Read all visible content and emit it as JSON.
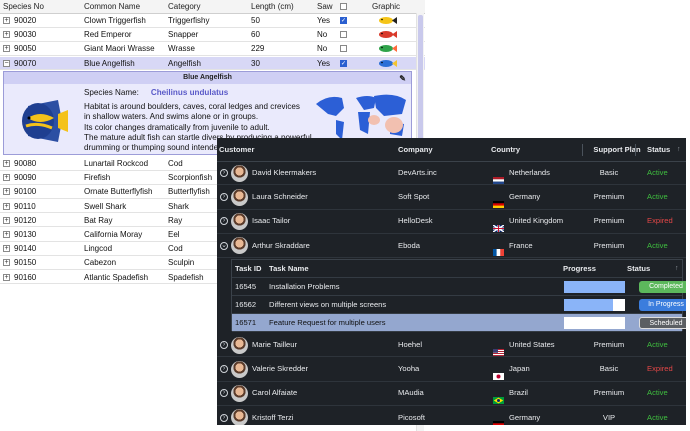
{
  "grid1": {
    "headers": [
      "Species No",
      "Common Name",
      "Category",
      "Length (cm)",
      "Saw",
      "Graphic"
    ],
    "rows_top": [
      {
        "no": "90020",
        "name": "Clown Triggerfish",
        "cat": "Triggerfishy",
        "len": "50",
        "saw": "Yes",
        "checked": true
      },
      {
        "no": "90030",
        "name": "Red Emperor",
        "cat": "Snapper",
        "len": "60",
        "saw": "No",
        "checked": false
      },
      {
        "no": "90050",
        "name": "Giant Maori Wrasse",
        "cat": "Wrasse",
        "len": "229",
        "saw": "No",
        "checked": false
      },
      {
        "no": "90070",
        "name": "Blue Angelfish",
        "cat": "Angelfish",
        "len": "30",
        "saw": "Yes",
        "checked": true
      }
    ],
    "detail": {
      "title": "Blue Angelfish",
      "species_label": "Species Name:",
      "species": "Cheilinus undulatus",
      "lines": [
        "Habitat is around boulders, caves, coral ledges and crevices",
        "in shallow waters. And swims alone or in groups.",
        "Its color changes dramatically from juvenile to adult.",
        "The mature adult fish can startle divers by producing a powerful",
        "drumming or thumping sound intended"
      ]
    },
    "rows_bottom": [
      {
        "no": "90080",
        "name": "Lunartail Rockcod",
        "cat": "Cod"
      },
      {
        "no": "90090",
        "name": "Firefish",
        "cat": "Scorpionfish"
      },
      {
        "no": "90100",
        "name": "Ornate Butterflyfish",
        "cat": "Butterflyfish"
      },
      {
        "no": "90110",
        "name": "Swell Shark",
        "cat": "Shark"
      },
      {
        "no": "90120",
        "name": "Bat Ray",
        "cat": "Ray"
      },
      {
        "no": "90130",
        "name": "California Moray",
        "cat": "Eel"
      },
      {
        "no": "90140",
        "name": "Lingcod",
        "cat": "Cod"
      },
      {
        "no": "90150",
        "name": "Cabezon",
        "cat": "Sculpin"
      },
      {
        "no": "90160",
        "name": "Atlantic Spadefish",
        "cat": "Spadefish"
      }
    ]
  },
  "grid2": {
    "headers": [
      "Customer",
      "Company",
      "Country",
      "Support Plan",
      "Status"
    ],
    "rows_top": [
      {
        "name": "David Kleermakers",
        "company": "DevArts.inc",
        "country": "Netherlands",
        "flag": "nl",
        "plan": "Basic",
        "status": "Active"
      },
      {
        "name": "Laura Schneider",
        "company": "Soft Spot",
        "country": "Germany",
        "flag": "de",
        "plan": "Premium",
        "status": "Active"
      },
      {
        "name": "Isaac Tailor",
        "company": "HelloDesk",
        "country": "United Kingdom",
        "flag": "uk",
        "plan": "Premium",
        "status": "Expired"
      },
      {
        "name": "Arthur Skraddare",
        "company": "Eboda",
        "country": "France",
        "flag": "fr",
        "plan": "Premium",
        "status": "Active"
      }
    ],
    "sub": {
      "headers": [
        "Task ID",
        "Task Name",
        "Progress",
        "Status"
      ],
      "rows": [
        {
          "id": "16545",
          "task": "Installation Problems",
          "progress": 1.0,
          "status": "Completed",
          "color": "#5cb85c"
        },
        {
          "id": "16562",
          "task": "Different views on multiple screens",
          "progress": 0.8,
          "status": "In Progress",
          "color": "#3b7ddd"
        },
        {
          "id": "16571",
          "task": "Feature Request for multiple users",
          "progress": 0.0,
          "status": "Scheduled",
          "color": "#5b5f63"
        }
      ]
    },
    "rows_bottom": [
      {
        "name": "Marie Tailleur",
        "company": "Hoehel",
        "country": "United States",
        "flag": "us",
        "plan": "Premium",
        "status": "Active"
      },
      {
        "name": "Valerie Skredder",
        "company": "Yooha",
        "country": "Japan",
        "flag": "jp",
        "plan": "Basic",
        "status": "Expired"
      },
      {
        "name": "Carol Alfaiate",
        "company": "MAudia",
        "country": "Brazil",
        "flag": "br",
        "plan": "Premium",
        "status": "Active"
      },
      {
        "name": "Kristoff Terzi",
        "company": "Picosoft",
        "country": "Germany",
        "flag": "de",
        "plan": "VIP",
        "status": "Active"
      }
    ]
  }
}
